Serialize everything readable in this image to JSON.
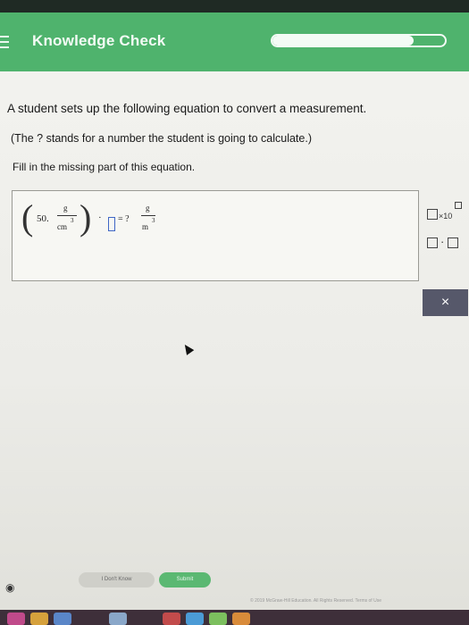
{
  "header": {
    "title": "Knowledge Check",
    "progress": 0.82
  },
  "question": {
    "text": "A student sets up the following equation to convert a measurement.",
    "note": "(The ? stands for a number the student is going to calculate.)",
    "instruction": "Fill in the missing part of this equation."
  },
  "equation": {
    "coefficient": "50.",
    "numerator_unit": "g",
    "denominator_unit": "cm",
    "denominator_exponent": "3",
    "operator": "·",
    "equals": "= ?",
    "result_numerator": "g",
    "result_denominator": "m",
    "result_exponent": "3"
  },
  "tools": {
    "x10_label": "×10",
    "dot_label": "·",
    "clear_label": "×"
  },
  "footer": {
    "dont_know_label": "I Don't Know",
    "submit_label": "Submit",
    "copyright": "© 2019 McGraw-Hill Education. All Rights Reserved. Terms of Use"
  },
  "colors": {
    "brand_green": "#4fb36d",
    "slot_blue": "#3f66c5",
    "tool_dark": "#56586a"
  }
}
